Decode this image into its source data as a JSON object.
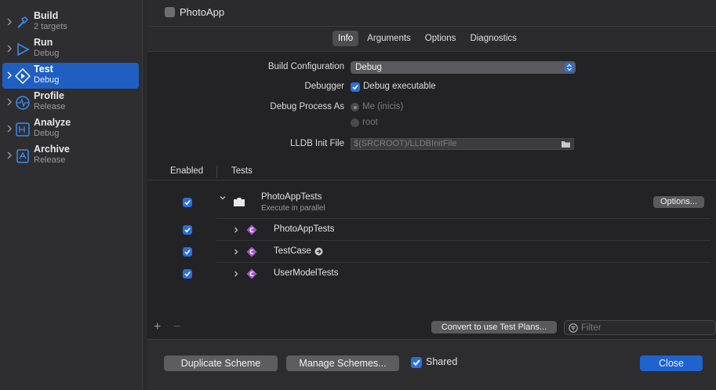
{
  "sidebar": {
    "actions": [
      {
        "name": "Build",
        "subtitle": "2 targets",
        "icon": "hammer-icon",
        "selected": false
      },
      {
        "name": "Run",
        "subtitle": "Debug",
        "icon": "play-icon",
        "selected": false
      },
      {
        "name": "Test",
        "subtitle": "Debug",
        "icon": "test-diamond-icon",
        "selected": true
      },
      {
        "name": "Profile",
        "subtitle": "Release",
        "icon": "instruments-icon",
        "selected": false
      },
      {
        "name": "Analyze",
        "subtitle": "Debug",
        "icon": "analyze-icon",
        "selected": false
      },
      {
        "name": "Archive",
        "subtitle": "Release",
        "icon": "archive-icon",
        "selected": false
      }
    ]
  },
  "header": {
    "target": "PhotoApp",
    "tabs": [
      {
        "label": "Info",
        "active": true
      },
      {
        "label": "Arguments",
        "active": false
      },
      {
        "label": "Options",
        "active": false
      },
      {
        "label": "Diagnostics",
        "active": false
      }
    ]
  },
  "form": {
    "build_configuration_label": "Build Configuration",
    "build_configuration_value": "Debug",
    "debugger_label": "Debugger",
    "debugger_option": "Debug executable",
    "debugger_checked": true,
    "debug_process_as_label": "Debug Process As",
    "process_me": "Me (inicis)",
    "process_root": "root",
    "lldb_label": "LLDB Init File",
    "lldb_placeholder": "$(SRCROOT)/LLDBInitFile"
  },
  "tests_table": {
    "columns": {
      "enabled": "Enabled",
      "tests": "Tests"
    },
    "plan": {
      "name": "PhotoAppTests",
      "subtitle": "Execute in parallel",
      "enabled": true,
      "options_label": "Options..."
    },
    "classes": [
      {
        "name": "PhotoAppTests",
        "enabled": true,
        "badge": "C"
      },
      {
        "name": "TestCase",
        "enabled": true,
        "badge": "C"
      },
      {
        "name": "UserModelTests",
        "enabled": true,
        "badge": "C"
      }
    ],
    "add_label": "+",
    "remove_label": "−",
    "convert_label": "Convert to use Test Plans...",
    "filter_placeholder": "Filter"
  },
  "footer": {
    "duplicate_label": "Duplicate Scheme",
    "manage_label": "Manage Schemes...",
    "shared_label": "Shared",
    "shared_checked": true,
    "close_label": "Close"
  },
  "colors": {
    "accent": "#1f63cf",
    "badge_purple": "#a553c9"
  }
}
